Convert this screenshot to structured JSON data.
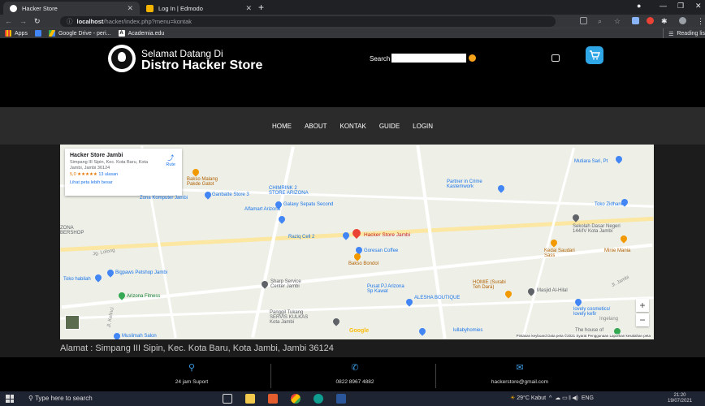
{
  "browser": {
    "tabs": [
      {
        "label": "Hacker Store",
        "active": true
      },
      {
        "label": "Log In | Edmodo",
        "active": false
      }
    ],
    "url_host": "localhost",
    "url_path": "/hacker/index.php?menu=kontak",
    "bookmarks": [
      "Apps",
      "Google Drive - peri...",
      "Academia.edu"
    ],
    "reading_list": "Reading lis"
  },
  "site": {
    "welcome": "Selamat Datang Di",
    "brand": "Distro Hacker Store",
    "search_label": "Search",
    "search_value": "",
    "nav": [
      "HOME",
      "ABOUT",
      "KONTAK",
      "GUIDE",
      "LOGIN"
    ]
  },
  "map": {
    "card": {
      "name": "Hacker Store Jambi",
      "address": "Simpang III Sipin, Kec. Kota Baru, Kota Jambi, Jambi 36124",
      "rating": "5,0 ★★★★★",
      "reviews": "13 ulasan",
      "route": "Rute",
      "larger_map": "Lihat peta lebih besar"
    },
    "places": [
      "Hacker Store Jambi",
      "Bakso Malang Pakde Gatot",
      "Zona Komputer Jambi",
      "Ganbatte Store 3",
      "CHIMRINK 2 STORE ARIZONA",
      "Galaxy Sepatu Second",
      "Alfamart Arizona",
      "Raziq Cell 2",
      "Goresan Coffee",
      "Bakso Bondol",
      "Partner in Crime Kastemwork",
      "Mutiara Sari, Pt",
      "Toko Zidhane",
      "Sekolah Dasar Negeri 144/IV Kota Jambi",
      "Kedai Saudari Sass",
      "Minie Mania",
      "Toko habilah",
      "Bigpaws Petshop Jambi",
      "Arizona Fitness",
      "Sharp Service Center Jambi",
      "Pusat PJ Arizona Sp Kawat",
      "ALESHA BOUTIQUE",
      "HOMIE (Surabi Teh Dara)",
      "Masjid Al-Hilal",
      "lovely cosmetics/ lovely kefir",
      "Panggil Tukang SERVIS KULKAS Kota Jambi",
      "lullabyhomies",
      "Muslimah Salon",
      "The house of",
      "ZONA BERSHOP",
      "Jl. Jambi",
      "Jg. Lolong",
      "Jl. Kelinci",
      "Ingelang"
    ],
    "google": "Google",
    "attribution": "Pintasan keyboard   Data peta ©2021   Syarat Penggunaan   Laporkan kesalahan peta"
  },
  "alamat": "Alamat : Simpang III Sipin, Kec. Kota Baru, Kota Jambi, Jambi 36124",
  "footer": {
    "support": "24 jam Suport",
    "phone": "0822 8967 4882",
    "email": "hackerstore@gmail.com"
  },
  "taskbar": {
    "search": "Type here to search",
    "weather": "29°C  Kabut",
    "lang": "ENG",
    "time": "21:20",
    "date": "19/07/2021"
  },
  "colors": {
    "accent": "#f7a21b",
    "cart": "#2fa6e6",
    "pin": "#ea4335",
    "footer_icon": "#3b9ae1"
  }
}
